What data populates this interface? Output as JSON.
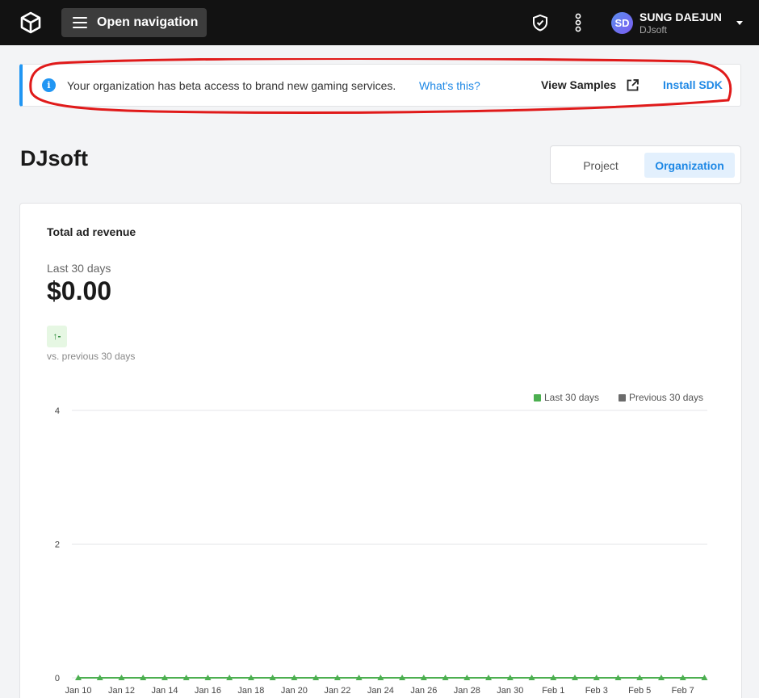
{
  "topbar": {
    "nav_label": "Open navigation",
    "user_initials": "SD",
    "user_name": "SUNG DAEJUN",
    "user_org": "DJsoft"
  },
  "banner": {
    "message": "Your organization has beta access to brand new gaming services.",
    "link": "What's this?",
    "view_samples": "View Samples",
    "install_sdk": "Install SDK",
    "accent": "#2196f3"
  },
  "page": {
    "title": "DJsoft",
    "toggle": {
      "project": "Project",
      "organization": "Organization",
      "selected": "Organization"
    }
  },
  "card": {
    "title": "Total ad revenue",
    "period": "Last 30 days",
    "value": "$0.00",
    "trend": "-",
    "comparison": "vs. previous 30 days"
  },
  "chart_data": {
    "type": "line",
    "x": [
      "Jan 10",
      "Jan 11",
      "Jan 12",
      "Jan 13",
      "Jan 14",
      "Jan 15",
      "Jan 16",
      "Jan 17",
      "Jan 18",
      "Jan 19",
      "Jan 20",
      "Jan 21",
      "Jan 22",
      "Jan 23",
      "Jan 24",
      "Jan 25",
      "Jan 26",
      "Jan 27",
      "Jan 28",
      "Jan 29",
      "Jan 30",
      "Jan 31",
      "Feb 1",
      "Feb 2",
      "Feb 3",
      "Feb 4",
      "Feb 5",
      "Feb 6",
      "Feb 7",
      "Feb 8"
    ],
    "x_tick_labels": [
      "Jan 10",
      "Jan 12",
      "Jan 14",
      "Jan 16",
      "Jan 18",
      "Jan 20",
      "Jan 22",
      "Jan 24",
      "Jan 26",
      "Jan 28",
      "Jan 30",
      "Feb 1",
      "Feb 3",
      "Feb 5",
      "Feb 7"
    ],
    "series": [
      {
        "name": "Last 30 days",
        "color": "#4caf50",
        "values": [
          0,
          0,
          0,
          0,
          0,
          0,
          0,
          0,
          0,
          0,
          0,
          0,
          0,
          0,
          0,
          0,
          0,
          0,
          0,
          0,
          0,
          0,
          0,
          0,
          0,
          0,
          0,
          0,
          0,
          0
        ]
      },
      {
        "name": "Previous 30 days",
        "color": "#6b6b6b",
        "values": []
      }
    ],
    "y_ticks": [
      0,
      2,
      4
    ],
    "ylim": [
      0,
      4
    ],
    "grid": true,
    "legend_position": "top-right"
  }
}
